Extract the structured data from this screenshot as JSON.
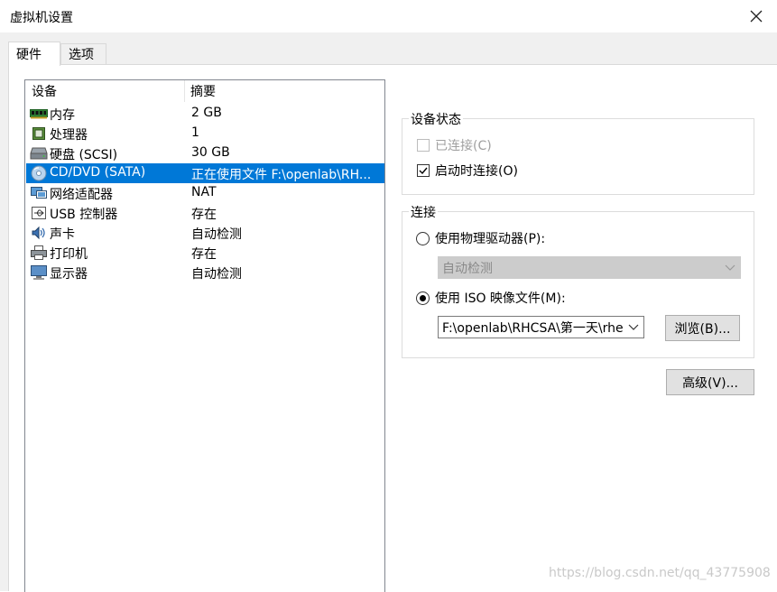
{
  "window": {
    "title": "虚拟机设置"
  },
  "tabs": [
    {
      "label": "硬件",
      "active": true
    },
    {
      "label": "选项",
      "active": false
    }
  ],
  "device_list": {
    "columns": [
      "设备",
      "摘要"
    ],
    "rows": [
      {
        "icon": "memory-icon",
        "name": "内存",
        "summary": "2 GB",
        "selected": false
      },
      {
        "icon": "processor-icon",
        "name": "处理器",
        "summary": "1",
        "selected": false
      },
      {
        "icon": "harddisk-icon",
        "name": "硬盘 (SCSI)",
        "summary": "30 GB",
        "selected": false
      },
      {
        "icon": "cd-dvd-icon",
        "name": "CD/DVD (SATA)",
        "summary": "正在使用文件 F:\\openlab\\RH...",
        "selected": true
      },
      {
        "icon": "network-adapter-icon",
        "name": "网络适配器",
        "summary": "NAT",
        "selected": false
      },
      {
        "icon": "usb-icon",
        "name": "USB 控制器",
        "summary": "存在",
        "selected": false
      },
      {
        "icon": "sound-card-icon",
        "name": "声卡",
        "summary": "自动检测",
        "selected": false
      },
      {
        "icon": "printer-icon",
        "name": "打印机",
        "summary": "存在",
        "selected": false
      },
      {
        "icon": "display-icon",
        "name": "显示器",
        "summary": "自动检测",
        "selected": false
      }
    ]
  },
  "device_status": {
    "title": "设备状态",
    "connected_label": "已连接(C)",
    "connected_checked": false,
    "connected_enabled": false,
    "connect_at_power_on_label": "启动时连接(O)",
    "connect_at_power_on_checked": true
  },
  "connection": {
    "title": "连接",
    "physical_drive_label": "使用物理驱动器(P):",
    "physical_drive_selected": false,
    "physical_drive_value": "自动检测",
    "iso_label": "使用 ISO 映像文件(M):",
    "iso_selected": true,
    "iso_path": "F:\\openlab\\RHCSA\\第一天\\rhe",
    "browse_label": "浏览(B)..."
  },
  "advanced_label": "高级(V)...",
  "watermark": "https://blog.csdn.net/qq_43775908",
  "colors": {
    "selection": "#0078d7",
    "client_bg": "#f0f0f0"
  }
}
